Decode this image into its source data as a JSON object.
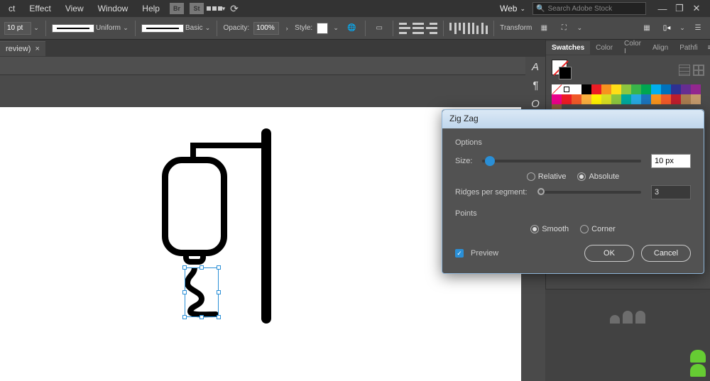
{
  "menu": {
    "items": [
      "ct",
      "Effect",
      "View",
      "Window",
      "Help"
    ],
    "doc_setup": "Web",
    "search_placeholder": "Search Adobe Stock"
  },
  "optbar": {
    "stroke_pt": "10 pt",
    "profile": "Uniform",
    "brush": "Basic",
    "opacity_label": "Opacity:",
    "opacity": "100%",
    "style_label": "Style:",
    "transform": "Transform"
  },
  "tab": {
    "title": "review)",
    "close": "×"
  },
  "panel": {
    "tabs": [
      "Swatches",
      "Color",
      "Color I",
      "Align",
      "Pathfi"
    ],
    "colors": [
      "#ffffff",
      "#000000",
      "#ec1c24",
      "#f7931e",
      "#ffde17",
      "#8dc63f",
      "#39b54a",
      "#00a651",
      "#00aeef",
      "#0072bc",
      "#2e3192",
      "#662d91",
      "#92278f",
      "#ec008c",
      "#ed1c24",
      "#f15a29",
      "#fbb040",
      "#fff200",
      "#d7df23",
      "#8dc63f",
      "#00a99d",
      "#27aae1",
      "#1c75bc",
      "#f7941d",
      "#f15a29",
      "#be1e2d",
      "#a97c50",
      "#c49a6c",
      "#8a5d3b"
    ]
  },
  "dialog": {
    "title": "Zig Zag",
    "options_label": "Options",
    "size_label": "Size:",
    "size_value": "10 px",
    "relative": "Relative",
    "absolute": "Absolute",
    "ridges_label": "Ridges per segment:",
    "ridges_value": "3",
    "points_label": "Points",
    "smooth": "Smooth",
    "corner": "Corner",
    "preview": "Preview",
    "ok": "OK",
    "cancel": "Cancel"
  },
  "typo": {
    "a": "A",
    "para": "¶",
    "o": "O"
  }
}
